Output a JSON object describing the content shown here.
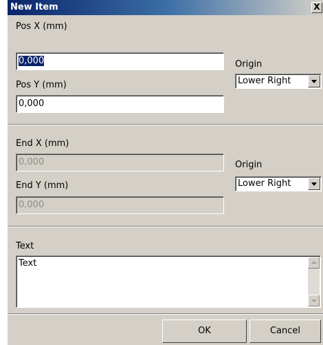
{
  "window": {
    "title": "New Item",
    "close_label": "X"
  },
  "start": {
    "pos_x_label": "Pos X (mm)",
    "pos_x_value": "0,000",
    "pos_y_label": "Pos Y (mm)",
    "pos_y_value": "0,000",
    "origin_label": "Origin",
    "origin_value": "Lower Right"
  },
  "end": {
    "end_x_label": "End X (mm)",
    "end_x_value": "0,000",
    "end_y_label": "End Y (mm)",
    "end_y_value": "0,000",
    "origin_label": "Origin",
    "origin_value": "Lower Right"
  },
  "text_section": {
    "label": "Text",
    "value": "Text"
  },
  "buttons": {
    "ok": "OK",
    "cancel": "Cancel"
  },
  "colors": {
    "dialog_bg": "#d4d0c8",
    "title_bar": "#0a246a",
    "selection": "#0a246a"
  }
}
